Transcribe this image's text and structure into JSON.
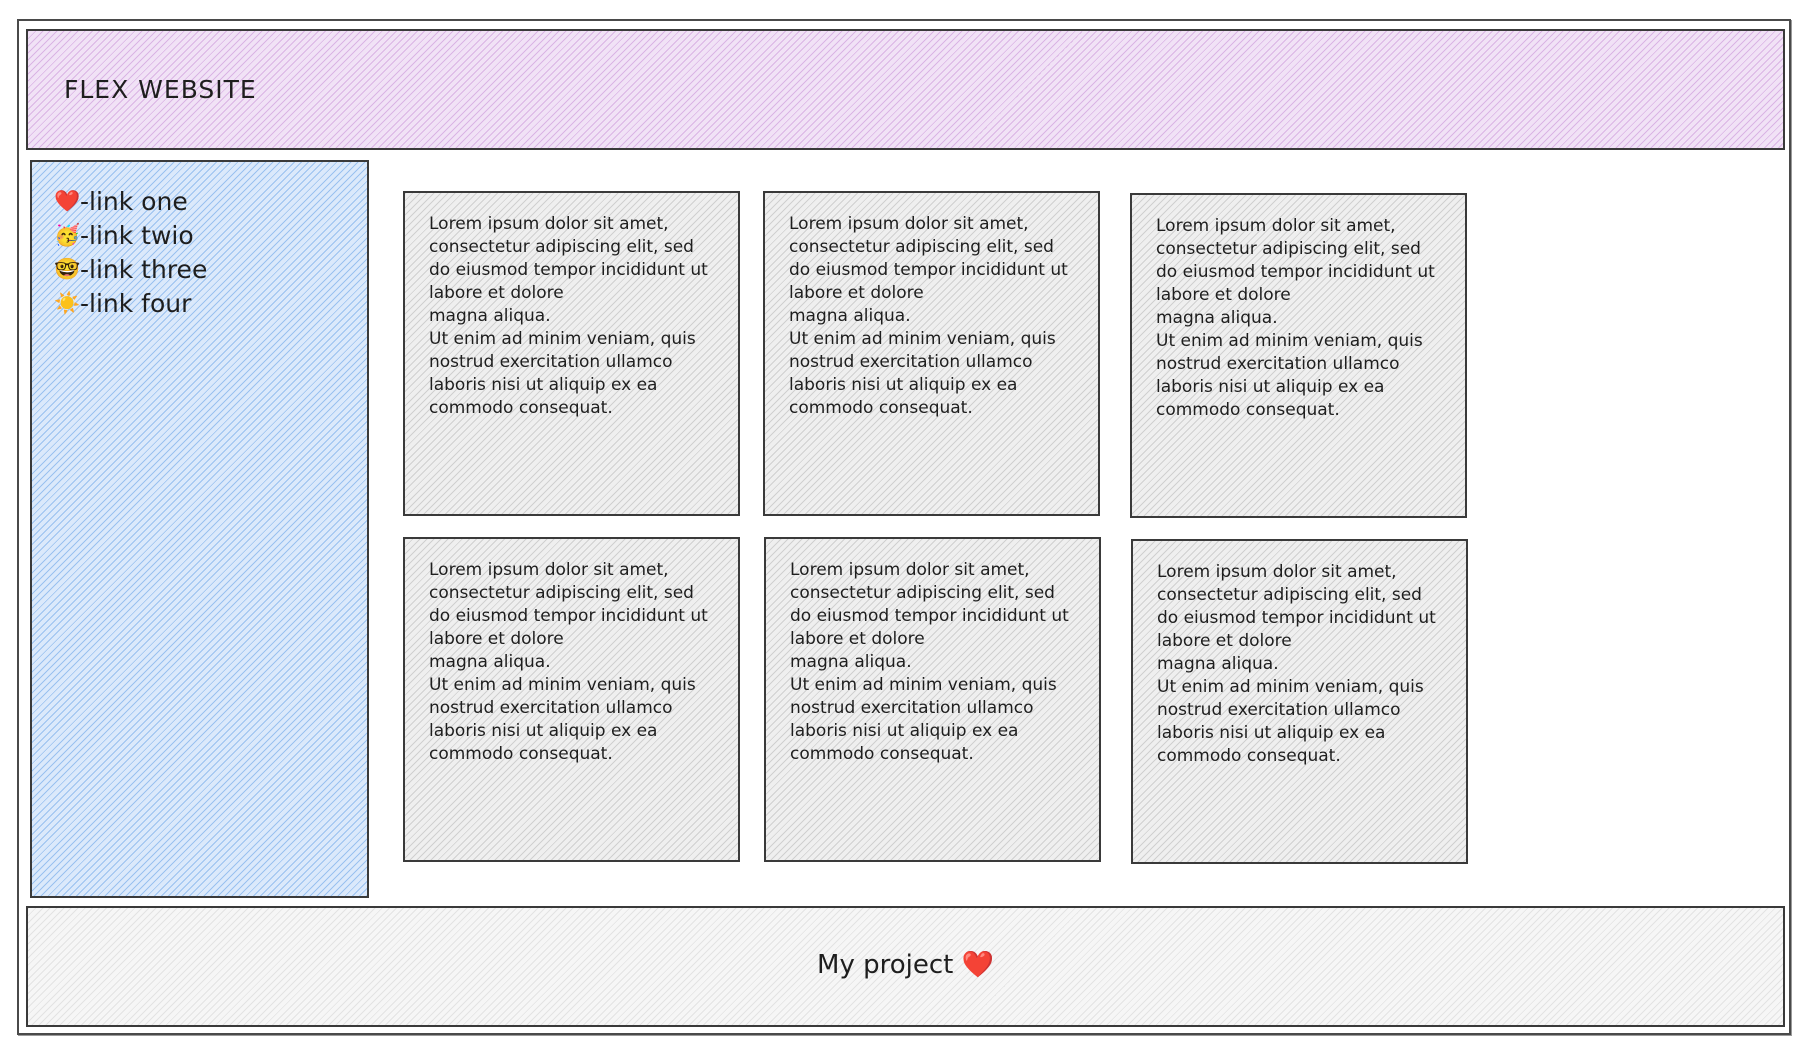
{
  "header": {
    "title": "FLEX WEBSITE"
  },
  "sidebar": {
    "items": [
      {
        "emoji": "❤️",
        "icon": "heart-icon",
        "label": "-link one"
      },
      {
        "emoji": "🥳",
        "icon": "party-face-icon",
        "label": "-link twio"
      },
      {
        "emoji": "🤓",
        "icon": "nerd-face-icon",
        "label": "-link three"
      },
      {
        "emoji": "☀️",
        "icon": "sun-icon",
        "label": "-link four"
      }
    ]
  },
  "cards": [
    {
      "text": "Lorem ipsum dolor sit amet,\nconsectetur adipiscing elit, sed\ndo eiusmod tempor incididunt ut\nlabore et dolore\nmagna aliqua.\nUt enim ad minim veniam, quis\nnostrud exercitation ullamco\nlaboris nisi ut aliquip ex ea\ncommodo consequat."
    },
    {
      "text": "Lorem ipsum dolor sit amet,\nconsectetur adipiscing elit, sed\ndo eiusmod tempor incididunt ut\nlabore et dolore\nmagna aliqua.\nUt enim ad minim veniam, quis\nnostrud exercitation ullamco\nlaboris nisi ut aliquip ex ea\ncommodo consequat."
    },
    {
      "text": "Lorem ipsum dolor sit amet,\nconsectetur adipiscing elit, sed\ndo eiusmod tempor incididunt ut\nlabore et dolore\nmagna aliqua.\nUt enim ad minim veniam, quis\nnostrud exercitation ullamco\nlaboris nisi ut aliquip ex ea\ncommodo consequat."
    },
    {
      "text": "Lorem ipsum dolor sit amet,\nconsectetur adipiscing elit, sed\ndo eiusmod tempor incididunt ut\nlabore et dolore\nmagna aliqua.\nUt enim ad minim veniam, quis\nnostrud exercitation ullamco\nlaboris nisi ut aliquip ex ea\ncommodo consequat."
    },
    {
      "text": "Lorem ipsum dolor sit amet,\nconsectetur adipiscing elit, sed\ndo eiusmod tempor incididunt ut\nlabore et dolore\nmagna aliqua.\nUt enim ad minim veniam, quis\nnostrud exercitation ullamco\nlaboris nisi ut aliquip ex ea\ncommodo consequat."
    },
    {
      "text": "Lorem ipsum dolor sit amet,\nconsectetur adipiscing elit, sed\ndo eiusmod tempor incididunt ut\nlabore et dolore\nmagna aliqua.\nUt enim ad minim veniam, quis\nnostrud exercitation ullamco\nlaboris nisi ut aliquip ex ea\ncommodo consequat."
    }
  ],
  "footer": {
    "text": "My project",
    "emoji": "❤️",
    "icon": "heart-icon"
  },
  "colors": {
    "header_fill": "#e6c7f0",
    "sidebar_fill": "#a5c8f5",
    "card_fill": "#d9d9d9",
    "footer_fill": "#ececec",
    "stroke": "#1e1e1e",
    "heart": "#e03131"
  }
}
